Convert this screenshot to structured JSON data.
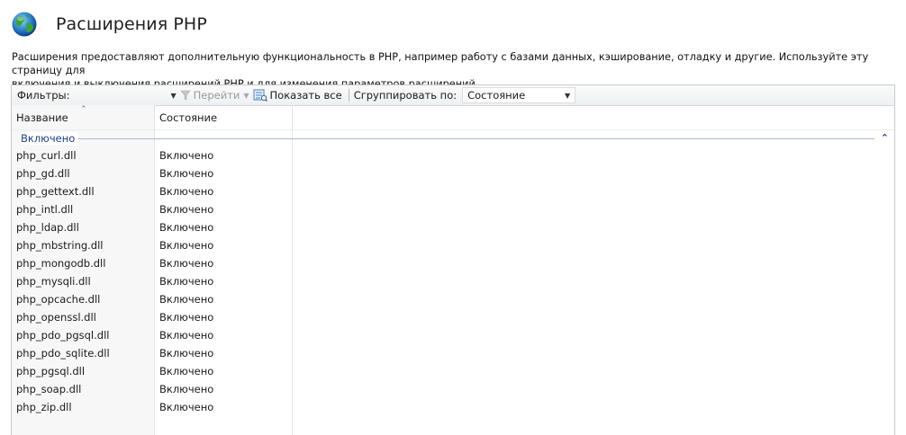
{
  "page": {
    "title": "Расширения PHP",
    "description_line1": "Расширения предоставляют дополнительную функциональность в PHP, например работу с базами данных, кэширование, отладку и другие. Используйте эту страницу для",
    "description_line2": "включения и выключения расширений PHP и для изменения параметров расширений.",
    "icon": "globe-icon"
  },
  "toolbar": {
    "filter_label": "Фильтры:",
    "filter_value": "",
    "go_label": "Перейти",
    "show_all_label": "Показать все",
    "group_by_label": "Сгруппировать по:",
    "group_by_value": "Состояние"
  },
  "grid": {
    "columns": [
      "Название",
      "Состояние"
    ],
    "group": "Включено",
    "rows": [
      {
        "name": "php_curl.dll",
        "state": "Включено"
      },
      {
        "name": "php_gd.dll",
        "state": "Включено"
      },
      {
        "name": "php_gettext.dll",
        "state": "Включено"
      },
      {
        "name": "php_intl.dll",
        "state": "Включено"
      },
      {
        "name": "php_ldap.dll",
        "state": "Включено"
      },
      {
        "name": "php_mbstring.dll",
        "state": "Включено"
      },
      {
        "name": "php_mongodb.dll",
        "state": "Включено"
      },
      {
        "name": "php_mysqli.dll",
        "state": "Включено"
      },
      {
        "name": "php_opcache.dll",
        "state": "Включено"
      },
      {
        "name": "php_openssl.dll",
        "state": "Включено"
      },
      {
        "name": "php_pdo_pgsql.dll",
        "state": "Включено"
      },
      {
        "name": "php_pdo_sqlite.dll",
        "state": "Включено"
      },
      {
        "name": "php_pgsql.dll",
        "state": "Включено"
      },
      {
        "name": "php_soap.dll",
        "state": "Включено"
      },
      {
        "name": "php_zip.dll",
        "state": "Включено"
      }
    ]
  },
  "colors": {
    "group_text": "#1e3f8a",
    "group_line": "#a8b6d4",
    "toolbar_bg": "#eef0f3"
  }
}
